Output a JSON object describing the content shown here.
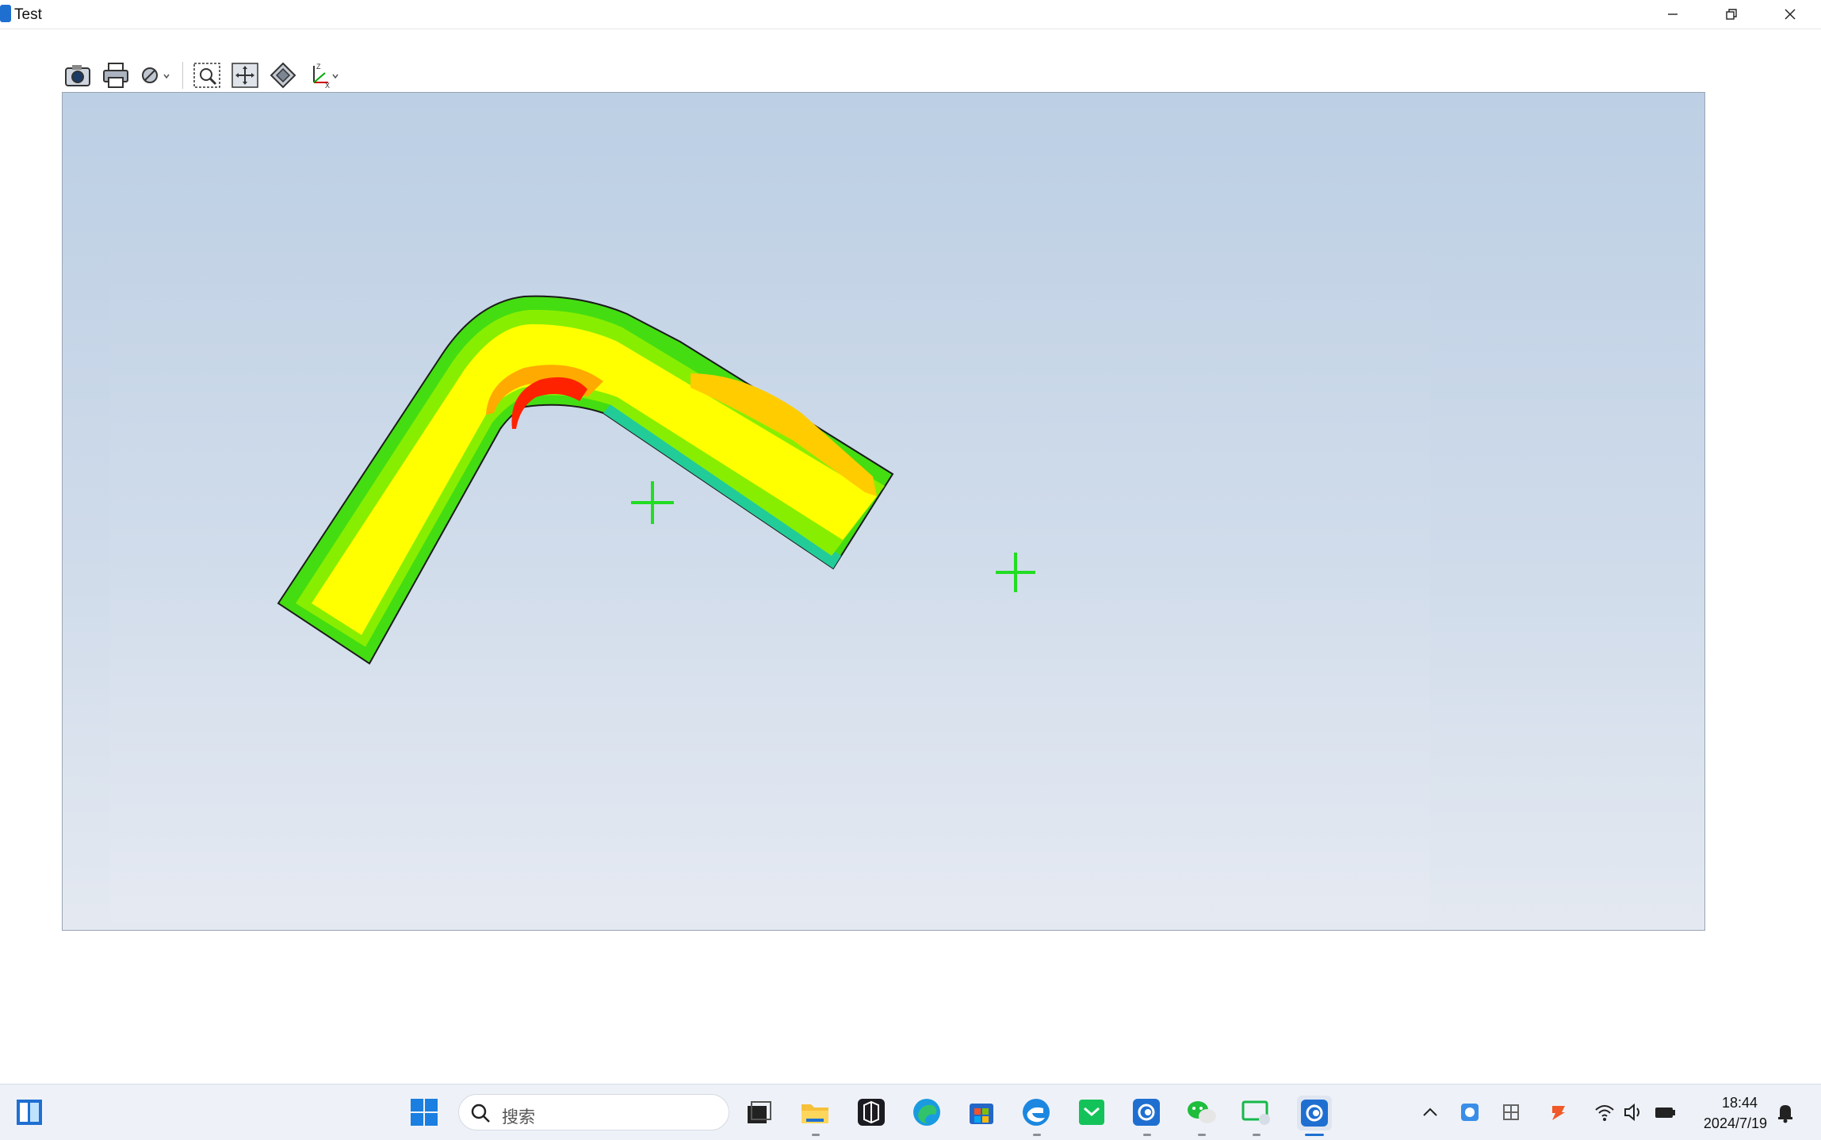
{
  "window": {
    "title": "Test",
    "controls": [
      "minimize",
      "restore",
      "close"
    ]
  },
  "toolbar": {
    "buttons": [
      {
        "name": "camera-icon",
        "label": "Screenshot"
      },
      {
        "name": "printer-icon",
        "label": "Print"
      },
      {
        "name": "display-mode-icon",
        "label": "Display mode"
      },
      {
        "name": "zoom-window-icon",
        "label": "Zoom window"
      },
      {
        "name": "pan-icon",
        "label": "Pan"
      },
      {
        "name": "fit-all-icon",
        "label": "Fit all"
      },
      {
        "name": "axes-view-icon",
        "label": "View axes"
      }
    ]
  },
  "viewport": {
    "model": "bent pipe contour plot",
    "contour_colors": [
      "#00a0ff",
      "#00d400",
      "#55ea00",
      "#a8f200",
      "#ffff00",
      "#ffcc00",
      "#ff8800",
      "#ff2200"
    ],
    "marker_color": "#22dd22"
  },
  "taskbar": {
    "search_placeholder": "搜索",
    "time": "18:44",
    "date": "2024/7/19",
    "apps": [
      "windows-start-icon",
      "task-view-icon",
      "file-explorer-icon",
      "dark-app-icon",
      "edge-icon",
      "store-icon",
      "edge-blue-icon",
      "green-app-icon",
      "swirl-app-icon",
      "wechat-icon",
      "screen-app-icon",
      "active-swirl-app-icon"
    ]
  }
}
